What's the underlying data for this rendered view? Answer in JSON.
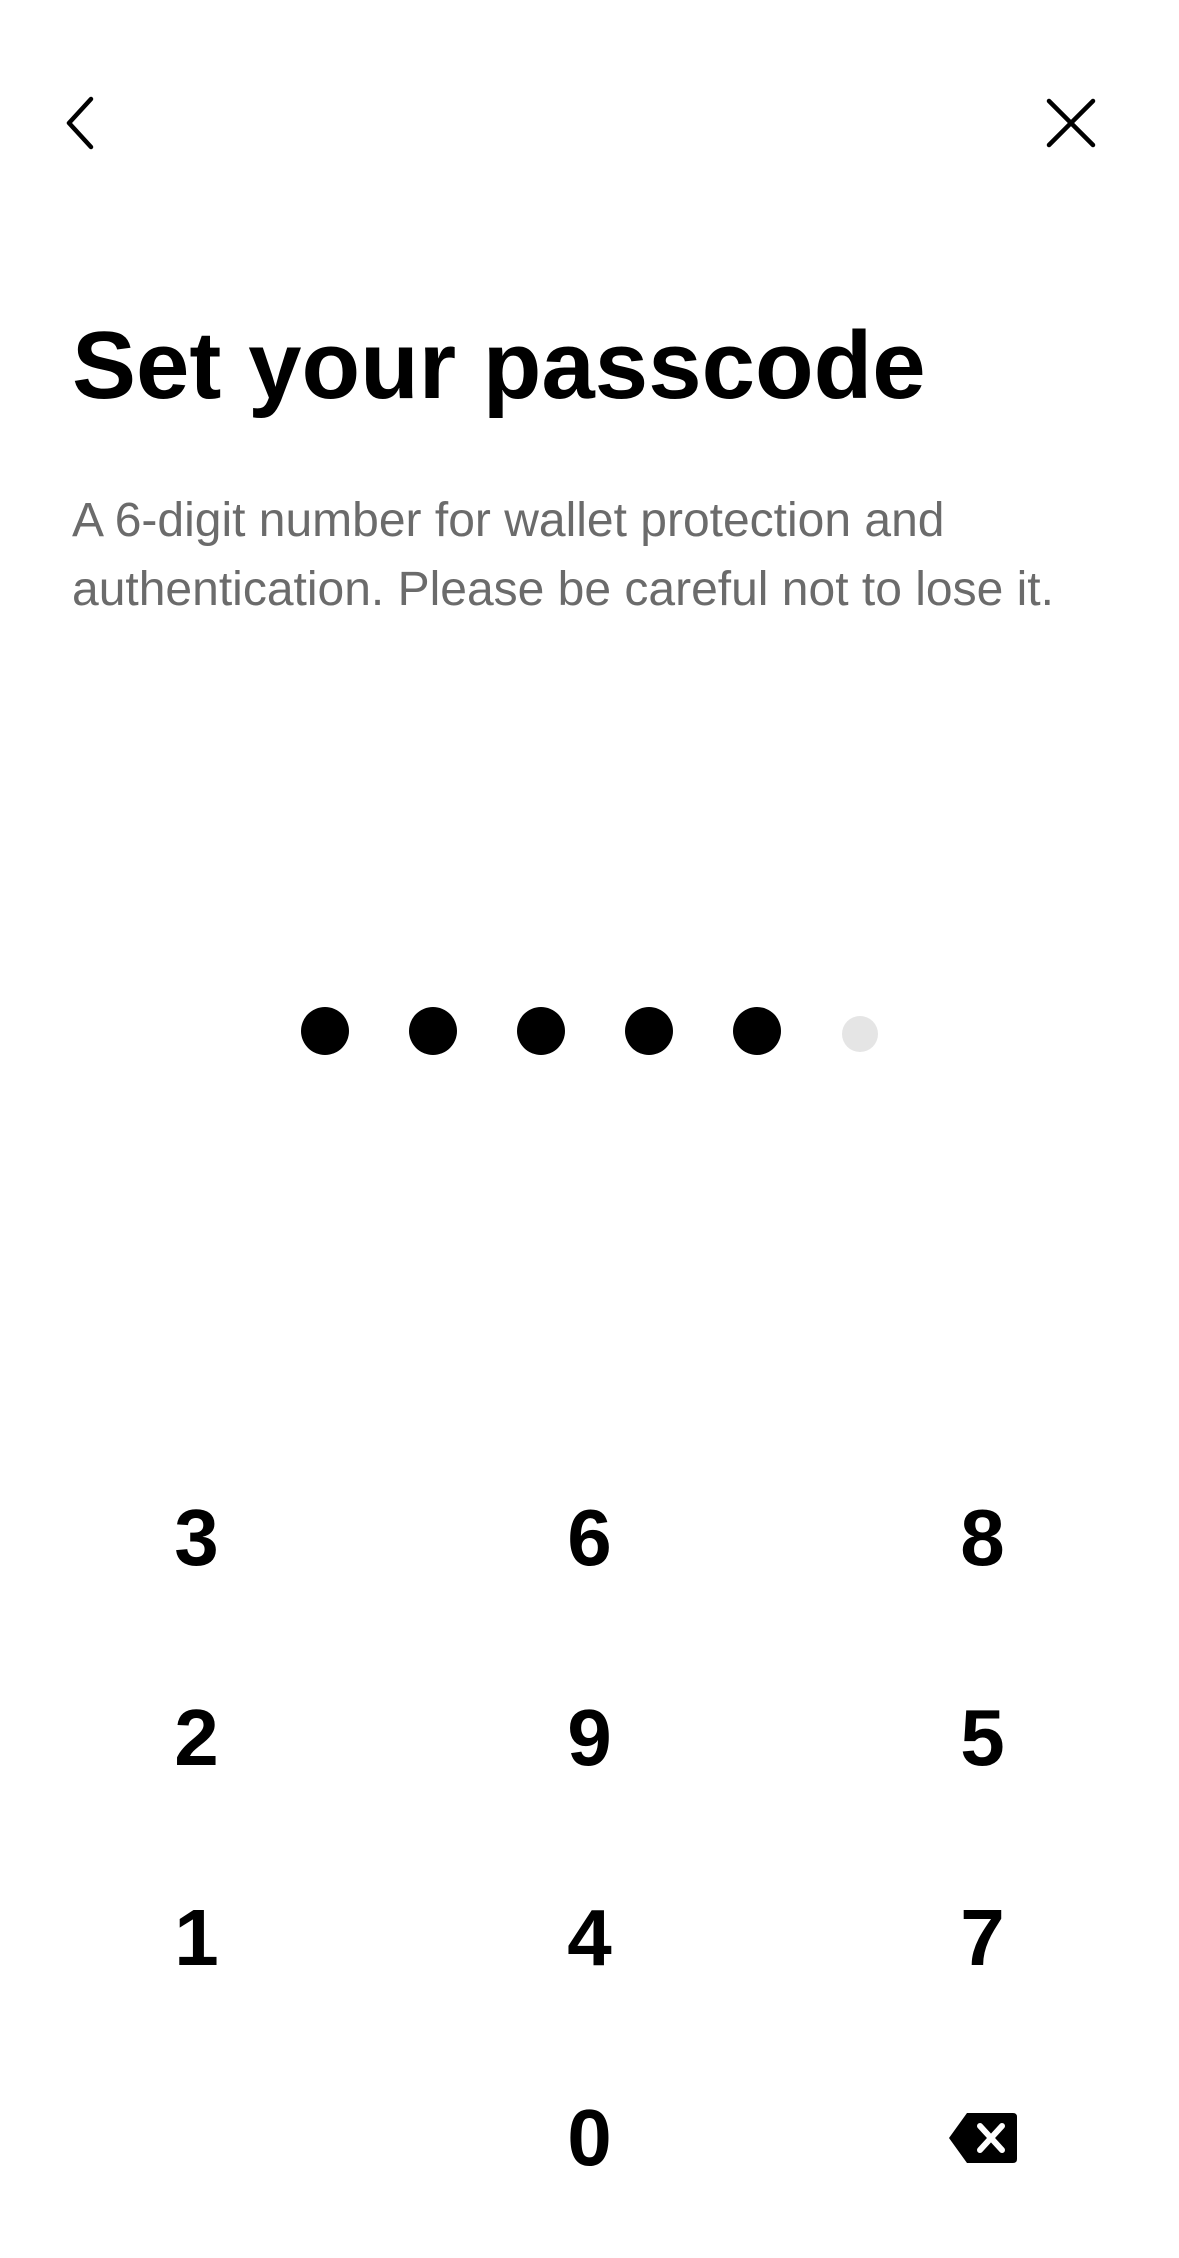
{
  "header": {
    "back_icon": "chevron-left-icon",
    "close_icon": "close-icon"
  },
  "content": {
    "title": "Set your passcode",
    "description": "A 6-digit number for wallet protection and authentication. Please be careful not to lose it."
  },
  "passcode": {
    "length": 6,
    "filled": 5,
    "filled_color": "#000000",
    "empty_color": "#e5e5e5"
  },
  "keypad": {
    "rows": [
      [
        "3",
        "6",
        "8"
      ],
      [
        "2",
        "9",
        "5"
      ],
      [
        "1",
        "4",
        "7"
      ],
      [
        "",
        "0",
        "backspace-icon"
      ]
    ]
  }
}
